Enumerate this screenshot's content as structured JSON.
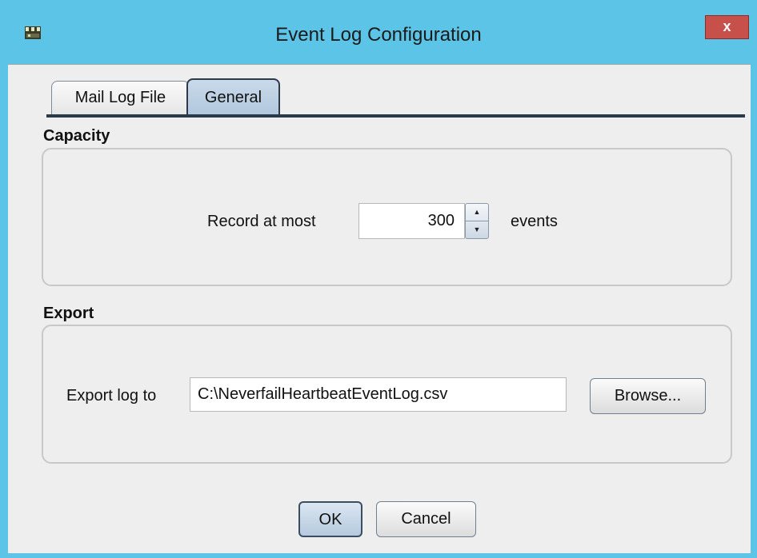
{
  "window": {
    "title": "Event Log Configuration",
    "close_label": "x",
    "icon": "app-icon"
  },
  "tabs": [
    {
      "label": "Mail Log File",
      "active": false
    },
    {
      "label": "General",
      "active": true
    }
  ],
  "capacity": {
    "section_title": "Capacity",
    "prefix_label": "Record at most",
    "value": "300",
    "suffix_label": "events"
  },
  "export": {
    "section_title": "Export",
    "label": "Export log to",
    "path": "C:\\NeverfailHeartbeatEventLog.csv",
    "browse_label": "Browse..."
  },
  "buttons": {
    "ok_label": "OK",
    "cancel_label": "Cancel"
  },
  "colors": {
    "frame": "#5cc4e6",
    "close": "#c7504b",
    "active_tab": "#b1c7de"
  }
}
